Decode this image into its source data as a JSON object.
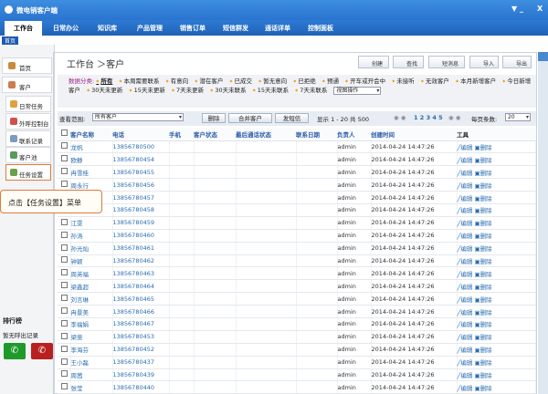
{
  "window": {
    "title": "微电销客户端",
    "min": "▼ _",
    "close": "X"
  },
  "tabs": [
    "工作台",
    "日常办公",
    "知识库",
    "产品管理",
    "销售订单",
    "短信群发",
    "通话详单",
    "控制面板"
  ],
  "subtab": "首页",
  "sidebar": {
    "items": [
      "首页",
      "客户",
      "日常任务",
      "外呼控制台",
      "联系记录",
      "客户池",
      "任务设置"
    ],
    "rank_title": "排行榜",
    "no_calls": "暂无呼出记录"
  },
  "tooltip": "点击【任务设置】菜单",
  "page": {
    "title": "工作台 ＞客户",
    "buttons": [
      "创建",
      "查找",
      "短消息",
      "导入",
      "导出"
    ]
  },
  "categories": {
    "label": "数据分类:",
    "items": [
      "所有",
      "本周需要联系",
      "有意向",
      "潜在客户",
      "已成交",
      "暂无意向",
      "已拒绝",
      "预通",
      "开车或开会中",
      "未接听",
      "无效客户",
      "本月新增客户",
      "今日新增客户",
      "30天未更新",
      "15天未更新",
      "7天未更新",
      "30天未联系",
      "15天未联系",
      "7天未联系"
    ],
    "view_select": "视图操作"
  },
  "toolbar": {
    "scope_label": "查看范围:",
    "scope_value": "所有客户",
    "delete": "删除",
    "merge": "合并客户",
    "sms": "发短信",
    "paging": "显示 1 - 20 共 500",
    "pages": "1 2 3 4 5",
    "per_page_label": "每页条数:",
    "per_page": "20"
  },
  "table": {
    "headers": [
      "客户名称",
      "电话",
      "手机",
      "客户状态",
      "最后通话状态",
      "联系日期",
      "负责人",
      "创建时间",
      "工具"
    ],
    "rows": [
      [
        "龙帆",
        "13856780500"
      ],
      [
        "欧静",
        "13856780454"
      ],
      [
        "冉雪桂",
        "13856780455"
      ],
      [
        "周永行",
        "13856780456"
      ],
      [
        "",
        "13856780457"
      ],
      [
        "",
        "13856780458"
      ],
      [
        "江雯",
        "13856780459"
      ],
      [
        "孙涛",
        "13856780460"
      ],
      [
        "孙光灿",
        "13856780461"
      ],
      [
        "钟颖",
        "13856780462"
      ],
      [
        "周英福",
        "13856780463"
      ],
      [
        "梁鑫超",
        "13856780464"
      ],
      [
        "刘言琳",
        "13856780465"
      ],
      [
        "冉景美",
        "13856780466"
      ],
      [
        "李福娟",
        "13856780467"
      ],
      [
        "梁斐",
        "13856780453"
      ],
      [
        "李海芬",
        "13856780452"
      ],
      [
        "王小磊",
        "13856780437"
      ],
      [
        "周茜",
        "13856780439"
      ],
      [
        "张莹",
        "13856780440"
      ]
    ],
    "owner": "admin",
    "created": "2014-04-24 14:47:26",
    "edit": "╱编辑",
    "del": "▣删除"
  }
}
